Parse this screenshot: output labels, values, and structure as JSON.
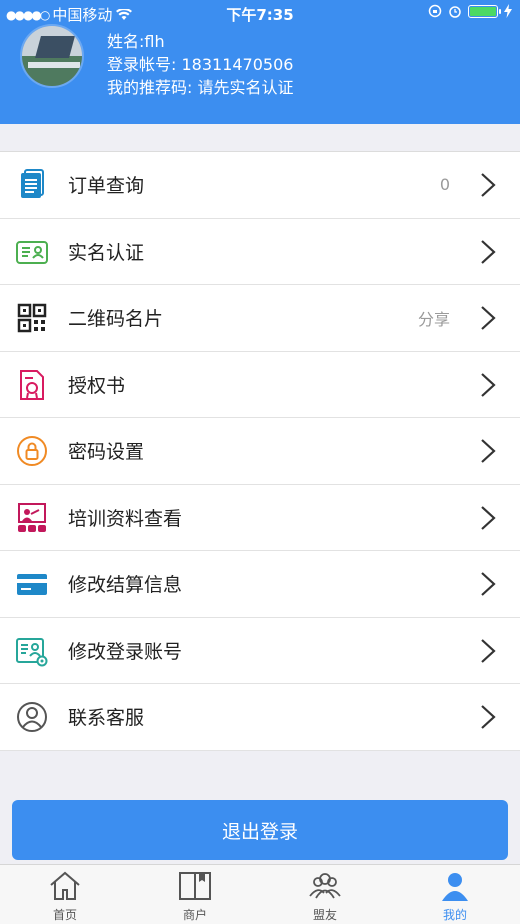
{
  "status_bar": {
    "carrier": "中国移动",
    "time": "下午7:35"
  },
  "profile": {
    "name_line": "姓名:flh",
    "account_line": "登录帐号: 18311470506",
    "referral_line": "我的推荐码: 请先实名认证"
  },
  "menu": [
    {
      "label": "订单查询",
      "extra": "0",
      "icon": "order-document-icon"
    },
    {
      "label": "实名认证",
      "extra": "",
      "icon": "id-card-icon"
    },
    {
      "label": "二维码名片",
      "extra": "分享",
      "icon": "qr-code-icon"
    },
    {
      "label": "授权书",
      "extra": "",
      "icon": "certificate-icon"
    },
    {
      "label": "密码设置",
      "extra": "",
      "icon": "lock-icon"
    },
    {
      "label": "培训资料查看",
      "extra": "",
      "icon": "training-presentation-icon"
    },
    {
      "label": "修改结算信息",
      "extra": "",
      "icon": "bank-card-icon"
    },
    {
      "label": "修改登录账号",
      "extra": "",
      "icon": "account-settings-icon"
    },
    {
      "label": "联系客服",
      "extra": "",
      "icon": "customer-service-icon"
    }
  ],
  "logout_label": "退出登录",
  "tabs": [
    {
      "label": "首页",
      "icon": "home-icon"
    },
    {
      "label": "商户",
      "icon": "book-icon"
    },
    {
      "label": "盟友",
      "icon": "friends-icon"
    },
    {
      "label": "我的",
      "icon": "person-icon"
    }
  ],
  "colors": {
    "primary": "#3c8ef0",
    "order": "#1e88c8",
    "id_card": "#4caf50",
    "qr": "#222222",
    "certificate": "#d81b60",
    "lock": "#f08a24",
    "training": "#c2185b",
    "bank_card": "#1e88c8",
    "account": "#26a69a",
    "service": "#555555"
  }
}
